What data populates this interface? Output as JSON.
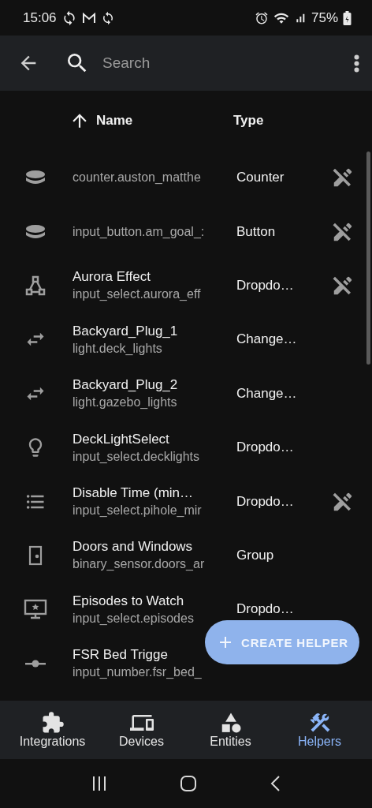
{
  "status_bar": {
    "time": "15:06",
    "battery": "75%"
  },
  "top_bar": {
    "search": {
      "placeholder": "Search"
    }
  },
  "table": {
    "columns": [
      {
        "label": "Name",
        "sorted": true
      },
      {
        "label": "Type",
        "sorted": false
      }
    ],
    "rows": [
      {
        "kind": "counter",
        "id": "counter.auston_matthe",
        "type": "Counter",
        "not_editable": true
      },
      {
        "kind": "button",
        "id": "input_button.am_goal_:",
        "type": "Button",
        "not_editable": true
      },
      {
        "kind": "graph",
        "name": "Aurora Effect",
        "id": "input_select.aurora_eff",
        "type": "Dropdo…",
        "not_editable": true
      },
      {
        "kind": "swap",
        "name": "Backyard_Plug_1",
        "id": "light.deck_lights",
        "type": "Change…",
        "not_editable": false
      },
      {
        "kind": "swap",
        "name": "Backyard_Plug_2",
        "id": "light.gazebo_lights",
        "type": "Change…",
        "not_editable": false
      },
      {
        "kind": "bulb",
        "name": "DeckLightSelect",
        "id": "input_select.decklights",
        "type": "Dropdo…",
        "not_editable": false
      },
      {
        "kind": "list",
        "name": "Disable Time (min…",
        "id": "input_select.pihole_mir",
        "type": "Dropdo…",
        "not_editable": true
      },
      {
        "kind": "door",
        "name": "Doors and Windows",
        "id": "binary_sensor.doors_ar",
        "type": "Group",
        "not_editable": false
      },
      {
        "kind": "monitor",
        "name": "Episodes to Watch",
        "id": "input_select.episodes",
        "type": "Dropdo…",
        "not_editable": false
      },
      {
        "kind": "slider",
        "name": "FSR Bed Trigge",
        "id": "input_number.fsr_bed_",
        "not_editable": false
      }
    ]
  },
  "fab": {
    "label": "CREATE HELPER"
  },
  "bottom_nav": [
    {
      "label": "Integrations",
      "kind": "puzzle",
      "selected": false
    },
    {
      "label": "Devices",
      "kind": "devices",
      "selected": false
    },
    {
      "label": "Entities",
      "kind": "shapes",
      "selected": false
    },
    {
      "label": "Helpers",
      "kind": "tools",
      "selected": true
    }
  ]
}
